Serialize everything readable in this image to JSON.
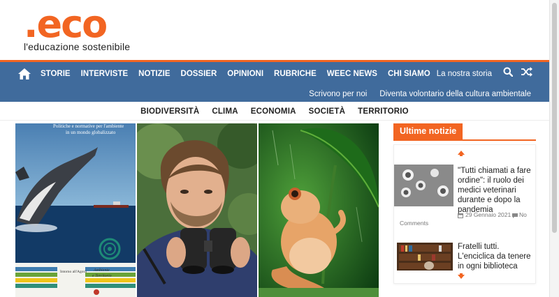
{
  "logo": {
    "mark": ".eco",
    "tagline": "l'educazione sostenibile"
  },
  "nav": {
    "items": [
      "STORIE",
      "INTERVISTE",
      "NOTIZIE",
      "DOSSIER",
      "OPINIONI",
      "RUBRICHE",
      "WEEC NEWS",
      "CHI SIAMO"
    ],
    "story_link": "La nostra storia",
    "secondary": [
      "Scrivono per noi",
      "Diventa volontario della cultura ambientale"
    ]
  },
  "categories": [
    "BIODIVERSITÀ",
    "CLIMA",
    "ECONOMIA",
    "SOCIETÀ",
    "TERRITORIO"
  ],
  "slider": {
    "cover_text_line1": "Politiche e normative per l'ambiente",
    "cover_text_line2": "in un mondo globalizzato",
    "cover_footer_left": "Intorno all'Agorà",
    "cover_footer_right1": "Ambiente",
    "cover_footer_right2": "e Territorio"
  },
  "sidebar": {
    "title": "Ultime notizie",
    "news": [
      {
        "title": "\"Tutti chiamati a fare ordine\": il ruolo dei medici veterinari durante e dopo la pandemia",
        "date": "29 Gennaio 2021",
        "comments": "No Comments"
      },
      {
        "title": "Fratelli tutti. L'enciclica da tenere in ogni biblioteca"
      }
    ]
  },
  "colors": {
    "brand_orange": "#f26522",
    "nav_blue": "#406b9c"
  }
}
